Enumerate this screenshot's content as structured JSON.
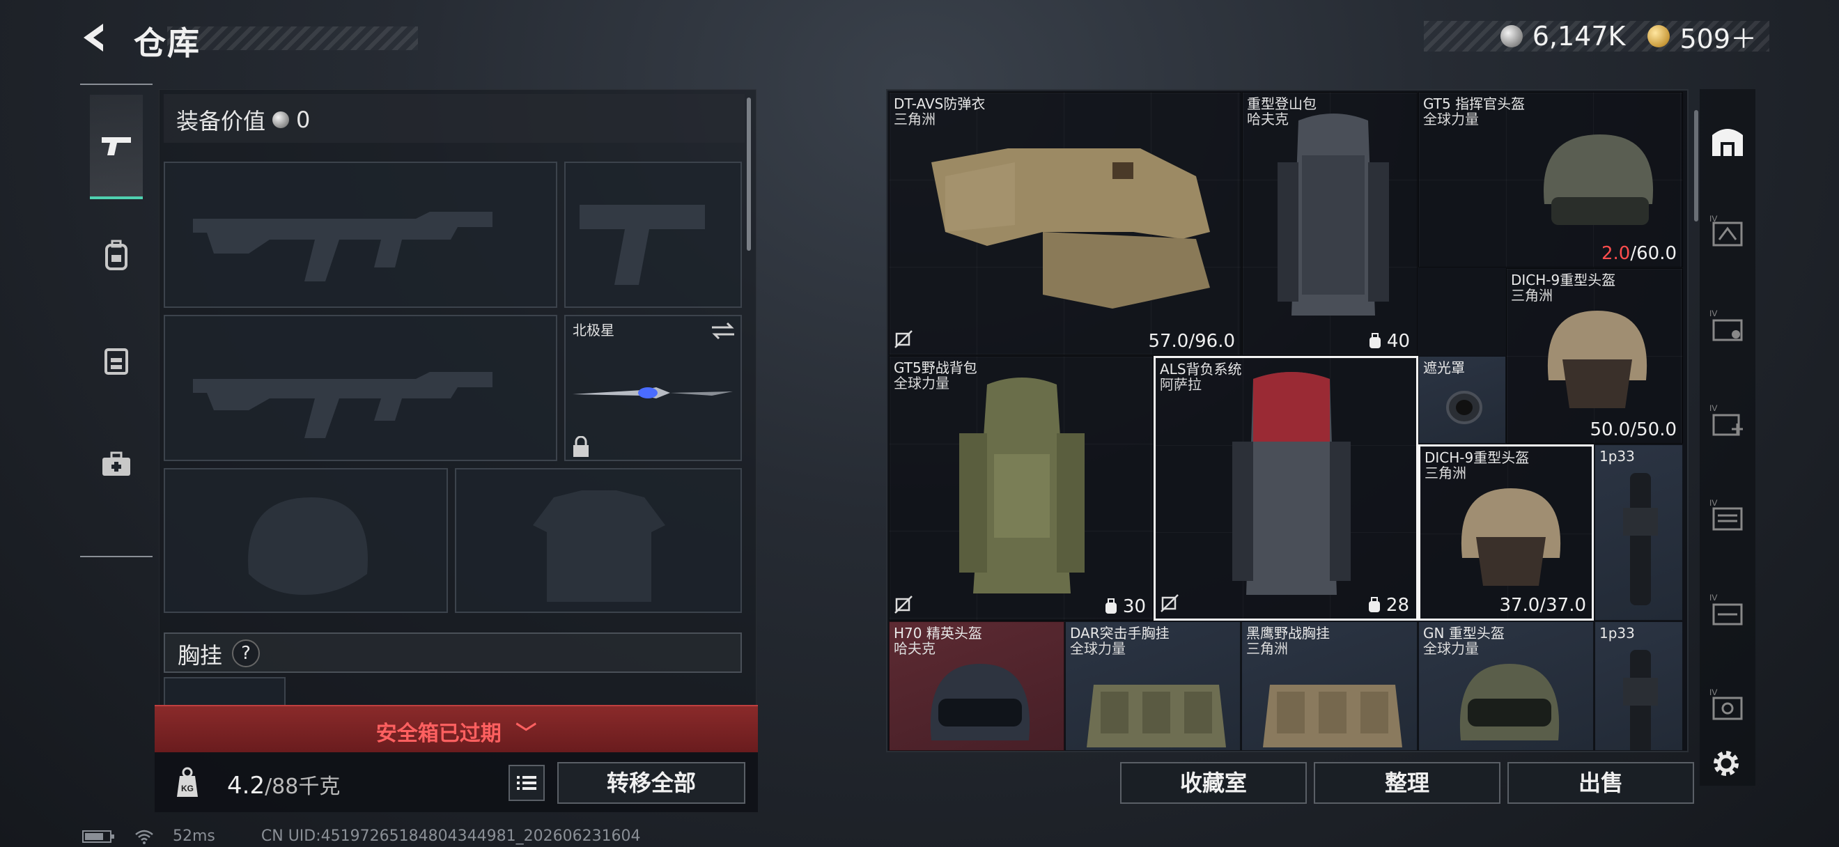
{
  "header": {
    "title": "仓库",
    "currency": [
      {
        "icon": "silver-coin-icon",
        "value": "6,147K"
      },
      {
        "icon": "gold-coin-icon",
        "value": "509＋"
      }
    ]
  },
  "left_nav": {
    "items": [
      {
        "icon": "pistol-icon",
        "active": true
      },
      {
        "icon": "backpack-icon",
        "active": false
      },
      {
        "icon": "vest-icon",
        "active": false
      },
      {
        "icon": "medkit-icon",
        "active": false
      }
    ]
  },
  "loadout": {
    "title_label": "装备价值",
    "value": "0",
    "melee_name": "北极星",
    "chest_label": "胸挂",
    "chest_help": "?"
  },
  "safebox": {
    "expired_text": "安全箱已过期"
  },
  "footer_left": {
    "weight_value": "4.2",
    "weight_capacity": "/88千克",
    "transfer_label": "转移全部"
  },
  "status_bar": {
    "ping": "52ms",
    "uid": "CN UID:4519726518480434498​1_202606231604"
  },
  "grid_items": [
    {
      "name": "DT-AVS防弹衣",
      "maker": "三角洲",
      "durability": "57.0/96.0",
      "color": "purple"
    },
    {
      "name": "重型登山包",
      "maker": "哈夫克",
      "capacity": "40",
      "color": "red"
    },
    {
      "name": "GT5 指挥官头盔",
      "maker": "全球力量",
      "durability_cur": "2.0",
      "durability_max": "/60.0",
      "color": "red"
    },
    {
      "name": "DICH-9重型头盔",
      "maker": "三角洲",
      "durability": "50.0/50.0",
      "color": "red"
    },
    {
      "name": "GT5野战背包",
      "maker": "全球力量",
      "capacity": "30",
      "color": "brown"
    },
    {
      "name": "ALS背负系统",
      "maker": "阿萨拉",
      "capacity": "28",
      "color": "brown"
    },
    {
      "name": "遮光罩",
      "maker": "",
      "color": "blue"
    },
    {
      "name": "DICH-9重型头盔",
      "maker": "三角洲",
      "durability": "37.0/37.0",
      "color": "brown"
    },
    {
      "name": "1p33",
      "maker": "",
      "color": "blue"
    },
    {
      "name": "H70 精英头盔",
      "maker": "哈夫克",
      "color": "red"
    },
    {
      "name": "DAR突击手胸挂",
      "maker": "全球力量",
      "color": "blue"
    },
    {
      "name": "黑鹰野战胸挂",
      "maker": "三角洲",
      "color": "blue"
    },
    {
      "name": "GN 重型头盔",
      "maker": "全球力量",
      "color": "blue"
    },
    {
      "name": "1p33",
      "maker": "",
      "color": "blue"
    }
  ],
  "actions": {
    "collection_label": "收藏室",
    "sort_label": "整理",
    "sell_label": "出售"
  },
  "right_sidebar": {
    "items": [
      "vault-icon",
      "slot-iv-1-icon",
      "slot-iv-2-icon",
      "slot-iv-3-icon",
      "slot-iv-4-icon",
      "slot-iv-5-icon",
      "slot-iv-6-icon"
    ]
  }
}
